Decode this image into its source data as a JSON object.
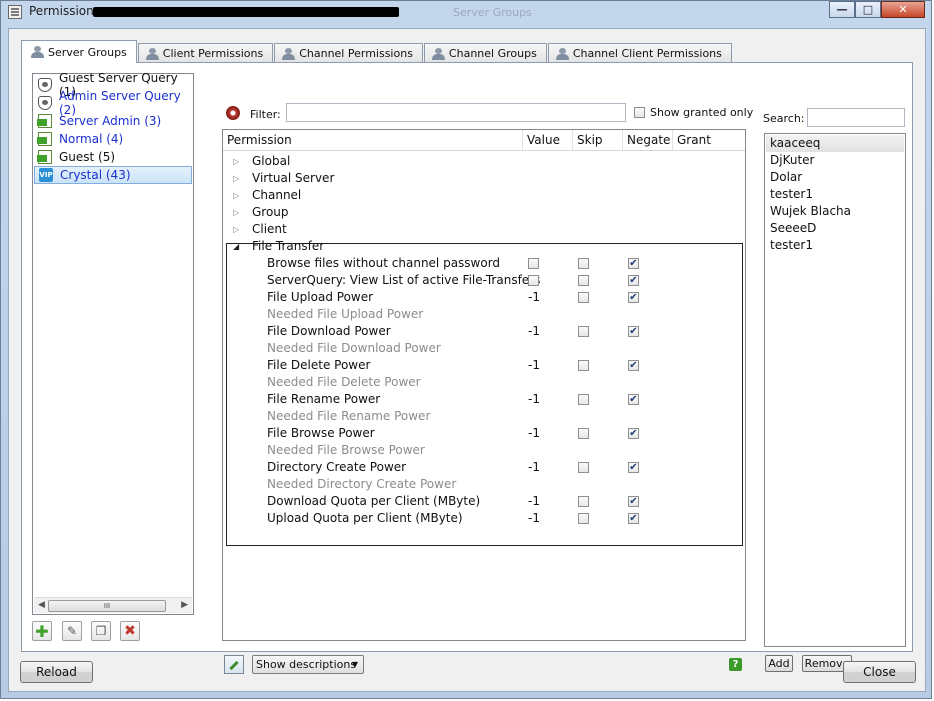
{
  "window": {
    "title": "Permissions - ",
    "background_hint": "Server Groups"
  },
  "tabs": [
    {
      "label": "Server Groups",
      "active": true
    },
    {
      "label": "Client Permissions"
    },
    {
      "label": "Channel Permissions"
    },
    {
      "label": "Channel Groups"
    },
    {
      "label": "Channel Client Permissions"
    }
  ],
  "groups": [
    {
      "label": "Guest Server Query (1)",
      "icon": "shield-icon",
      "color": "#111111"
    },
    {
      "label": "Admin Server Query (2)",
      "icon": "shield-icon",
      "color": "#1b2fd1"
    },
    {
      "label": "Server Admin (3)",
      "icon": "server-admin-icon",
      "color": "#1b2fd1"
    },
    {
      "label": "Normal (4)",
      "icon": "normal-icon",
      "color": "#1b2fd1"
    },
    {
      "label": "Guest (5)",
      "icon": "guest-icon",
      "color": "#111111"
    },
    {
      "label": "Crystal (43)",
      "icon": "vip-icon",
      "color": "#1b2fd1",
      "selected": true
    }
  ],
  "group_scroll_label": "III",
  "filter": {
    "label": "Filter:",
    "value": "",
    "show_granted_label": "Show granted only",
    "show_granted_checked": false
  },
  "columns": {
    "permission": "Permission",
    "value": "Value",
    "skip": "Skip",
    "negate": "Negate",
    "grant": "Grant"
  },
  "categories": [
    "Global",
    "Virtual Server",
    "Channel",
    "Group",
    "Client"
  ],
  "file_transfer": {
    "label": "File Transfer",
    "rows": [
      {
        "name": "Browse files without channel password",
        "value": "",
        "value_checkbox": true,
        "skip": false,
        "negate": true
      },
      {
        "name": "ServerQuery: View List of active File-Transfers",
        "value": "",
        "value_checkbox": true,
        "skip": false,
        "negate": true
      },
      {
        "name": "File Upload Power",
        "value": "-1",
        "skip": false,
        "negate": true
      },
      {
        "name": "Needed File Upload Power",
        "needed": true
      },
      {
        "name": "File Download Power",
        "value": "-1",
        "skip": false,
        "negate": true
      },
      {
        "name": "Needed File Download Power",
        "needed": true
      },
      {
        "name": "File Delete Power",
        "value": "-1",
        "skip": false,
        "negate": true
      },
      {
        "name": "Needed File Delete Power",
        "needed": true
      },
      {
        "name": "File Rename Power",
        "value": "-1",
        "skip": false,
        "negate": true
      },
      {
        "name": "Needed File Rename Power",
        "needed": true
      },
      {
        "name": "File Browse Power",
        "value": "-1",
        "skip": false,
        "negate": true
      },
      {
        "name": "Needed File Browse Power",
        "needed": true
      },
      {
        "name": "Directory Create Power",
        "value": "-1",
        "skip": false,
        "negate": true
      },
      {
        "name": "Needed Directory Create Power",
        "needed": true
      },
      {
        "name": "Download Quota per Client (MByte)",
        "value": "-1",
        "skip": false,
        "negate": true
      },
      {
        "name": "Upload Quota per Client (MByte)",
        "value": "-1",
        "skip": false,
        "negate": true
      }
    ]
  },
  "show_descriptions": "Show descriptions",
  "search": {
    "label": "Search:",
    "value": ""
  },
  "users": [
    {
      "name": "kaaceeq",
      "selected": true
    },
    {
      "name": "DjKuter"
    },
    {
      "name": "Dolar"
    },
    {
      "name": "tester1"
    },
    {
      "name": "Wujek Blacha"
    },
    {
      "name": "SeeeeD"
    },
    {
      "name": "tester1"
    }
  ],
  "buttons": {
    "add": "Add",
    "remove": "Remove",
    "reload": "Reload",
    "close": "Close"
  },
  "colors": {
    "accent_blue": "#1b2fd1",
    "add_green": "#3fa02a",
    "delete_red": "#c0392b",
    "needed_gray": "#8c8c8c"
  }
}
